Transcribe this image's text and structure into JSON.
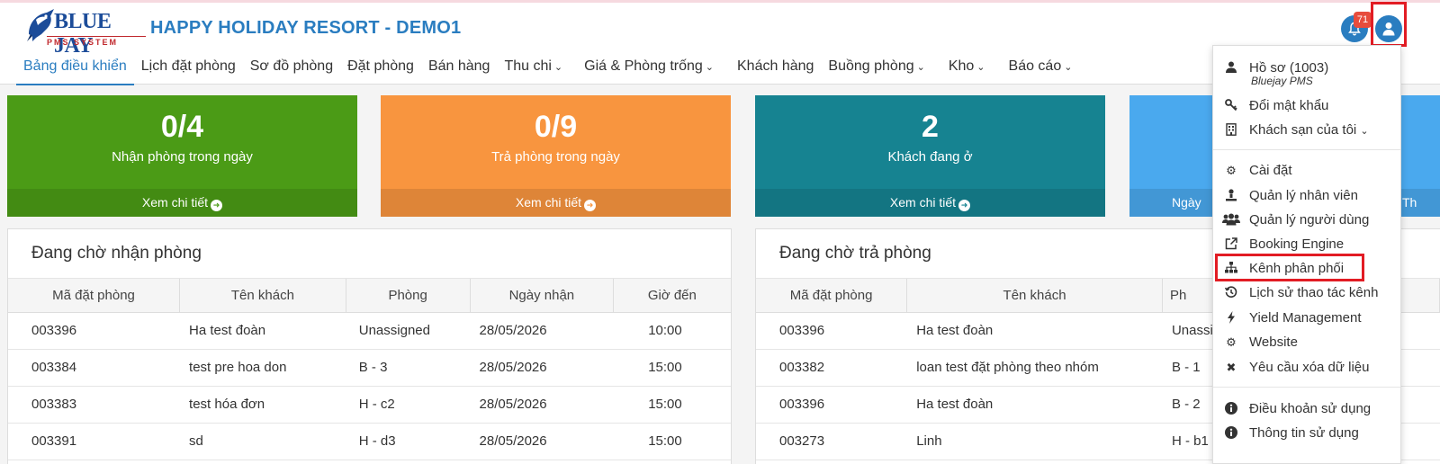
{
  "logo": {
    "name": "BLUE JAY",
    "sub": "PMS SYSTEM"
  },
  "hotel_title": "HAPPY HOLIDAY RESORT - DEMO1",
  "nav": [
    {
      "label": "Bảng điều khiển"
    },
    {
      "label": "Lịch đặt phòng"
    },
    {
      "label": "Sơ đồ phòng"
    },
    {
      "label": "Đặt phòng"
    },
    {
      "label": "Bán hàng"
    },
    {
      "label": "Thu chi"
    },
    {
      "label": "Giá & Phòng trống"
    },
    {
      "label": "Khách hàng"
    },
    {
      "label": "Buồng phòng"
    },
    {
      "label": "Kho"
    },
    {
      "label": "Báo cáo"
    }
  ],
  "notifications": {
    "count": "71"
  },
  "cards": [
    {
      "value": "0/4",
      "label": "Nhận phòng trong ngày",
      "footer": "Xem chi tiết",
      "color": "#4b9b16"
    },
    {
      "value": "0/9",
      "label": "Trả phòng trong ngày",
      "footer": "Xem chi tiết",
      "color": "#f8953f"
    },
    {
      "value": "2",
      "label": "Khách đang ở",
      "footer": "Xem chi tiết",
      "color": "#168391"
    },
    {
      "footer_left": "Ngày",
      "footer_right": "Th",
      "color": "#4aa9ee"
    }
  ],
  "checkin_panel": {
    "title": "Đang chờ nhận phòng",
    "headers": [
      "Mã đặt phòng",
      "Tên khách",
      "Phòng",
      "Ngày nhận",
      "Giờ đến"
    ],
    "rows": [
      [
        "003396",
        "Ha test đoàn",
        "Unassigned",
        "28/05/2026",
        "10:00"
      ],
      [
        "003384",
        "test pre hoa don",
        "B - 3",
        "28/05/2026",
        "15:00"
      ],
      [
        "003383",
        "test hóa đơn",
        "H - c2",
        "28/05/2026",
        "15:00"
      ],
      [
        "003391",
        "sd",
        "H - d3",
        "28/05/2026",
        "15:00"
      ]
    ]
  },
  "checkout_panel": {
    "title": "Đang chờ trả phòng",
    "headers": [
      "Mã đặt phòng",
      "Tên khách",
      "Ph"
    ],
    "rows": [
      [
        "003396",
        "Ha test đoàn",
        "Unassi"
      ],
      [
        "003382",
        "loan test đặt phòng theo nhóm",
        "B - 1"
      ],
      [
        "003396",
        "Ha test đoàn",
        "B - 2"
      ],
      [
        "003273",
        "Linh",
        "H - b1"
      ]
    ]
  },
  "user_menu": {
    "profile": "Hồ sơ (1003)",
    "profile_sub": "Bluejay PMS",
    "change_password": "Đổi mật khẩu",
    "my_hotels": "Khách sạn của tôi",
    "settings": "Cài đặt",
    "staff_management": "Quản lý nhân viên",
    "user_management": "Quản lý người dùng",
    "booking_engine": "Booking Engine",
    "channel_manager": "Kênh phân phối",
    "channel_history": "Lịch sử thao tác kênh",
    "yield_management": "Yield Management",
    "website": "Website",
    "delete_data_request": "Yêu cầu xóa dữ liệu",
    "terms": "Điều khoản sử dụng",
    "usage_info": "Thông tin sử dụng"
  },
  "colors": {
    "primary": "#2a7dc0",
    "highlight": "#e21c24"
  }
}
